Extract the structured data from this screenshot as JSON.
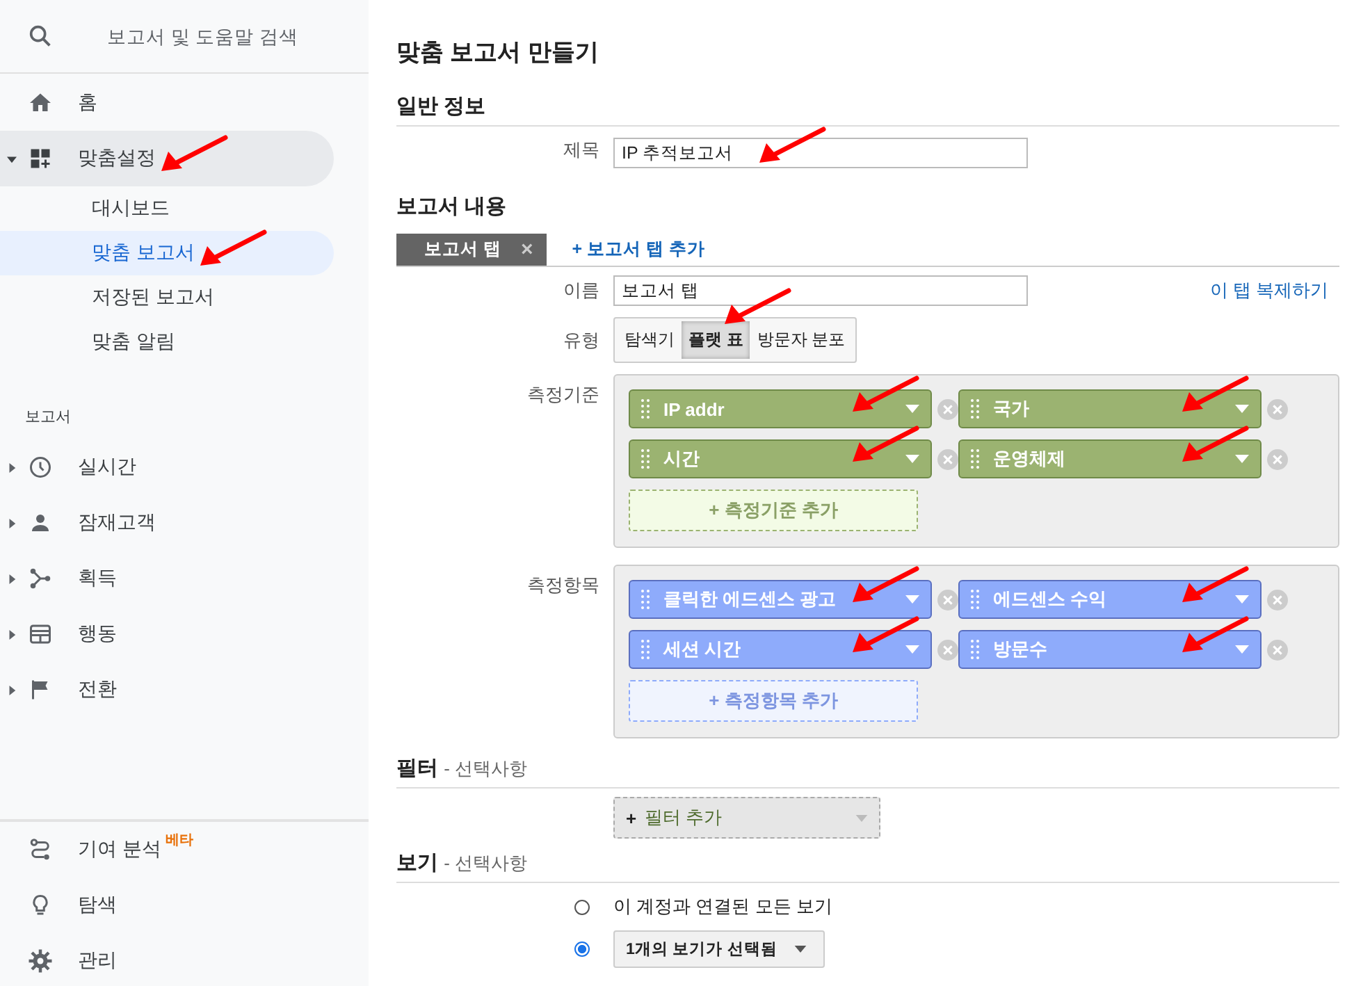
{
  "sidebar": {
    "search": {
      "placeholder": "보고서 및 도움말 검색"
    },
    "top_items": [
      {
        "label": "홈",
        "selected": false,
        "marked": false
      },
      {
        "label": "맞춤설정",
        "selected": false,
        "expanded": true,
        "marked": true,
        "children": [
          {
            "label": "대시보드",
            "selected": false,
            "marked": false
          },
          {
            "label": "맞춤 보고서",
            "selected": true,
            "marked": true
          },
          {
            "label": "저장된 보고서",
            "selected": false,
            "marked": false
          },
          {
            "label": "맞춤 알림",
            "selected": false,
            "marked": false
          }
        ]
      }
    ],
    "section_heading": "보고서",
    "report_items": [
      {
        "label": "실시간",
        "expanded": false
      },
      {
        "label": "잠재고객",
        "expanded": false
      },
      {
        "label": "획득",
        "expanded": false
      },
      {
        "label": "행동",
        "expanded": false
      },
      {
        "label": "전환",
        "expanded": false
      }
    ],
    "bottom_items": [
      {
        "label": "기여 분석",
        "badge": "베타"
      },
      {
        "label": "탐색"
      },
      {
        "label": "관리"
      }
    ]
  },
  "page_title": "맞춤 보고서 만들기",
  "general": {
    "heading": "일반 정보",
    "title_field": {
      "label": "제목",
      "value": "IP 추적보고서",
      "marked": true
    }
  },
  "content": {
    "heading": "보고서 내용",
    "tabs": [
      {
        "label": "보고서 탭",
        "close": "×",
        "selected": true
      }
    ],
    "add_tab": "+ 보고서 탭 추가",
    "name_field": {
      "label": "이름",
      "value": "보고서 탭"
    },
    "duplicate_link": "이 탭 복제하기",
    "type": {
      "label": "유형",
      "options": [
        {
          "label": "탐색기",
          "selected": false,
          "marked": false
        },
        {
          "label": "플랫 표",
          "selected": true,
          "marked": true
        },
        {
          "label": "방문자 분포",
          "selected": false,
          "marked": false
        }
      ]
    },
    "dimensions": {
      "label": "측정기준",
      "chips": [
        {
          "label": "IP addr",
          "marked": true
        },
        {
          "label": "국가",
          "marked": true
        },
        {
          "label": "시간",
          "marked": true
        },
        {
          "label": "운영체제",
          "marked": true
        }
      ],
      "add": "+ 측정기준 추가"
    },
    "metrics": {
      "label": "측정항목",
      "chips": [
        {
          "label": "클릭한 에드센스 광고",
          "marked": true
        },
        {
          "label": "에드센스 수익",
          "marked": true
        },
        {
          "label": "세션 시간",
          "marked": true
        },
        {
          "label": "방문수",
          "marked": true
        }
      ],
      "add": "+ 측정항목 추가"
    }
  },
  "filter": {
    "heading": "필터",
    "note": "- 선택사항",
    "add_plus": "+",
    "add_label": "필터 추가"
  },
  "views": {
    "heading": "보기",
    "note": "- 선택사항",
    "options": [
      {
        "kind": "text",
        "label": "이 계정과 연결된 모든 보기",
        "selected": false
      },
      {
        "kind": "dropdown",
        "label": "1개의 보기가 선택됨",
        "selected": true
      }
    ]
  }
}
